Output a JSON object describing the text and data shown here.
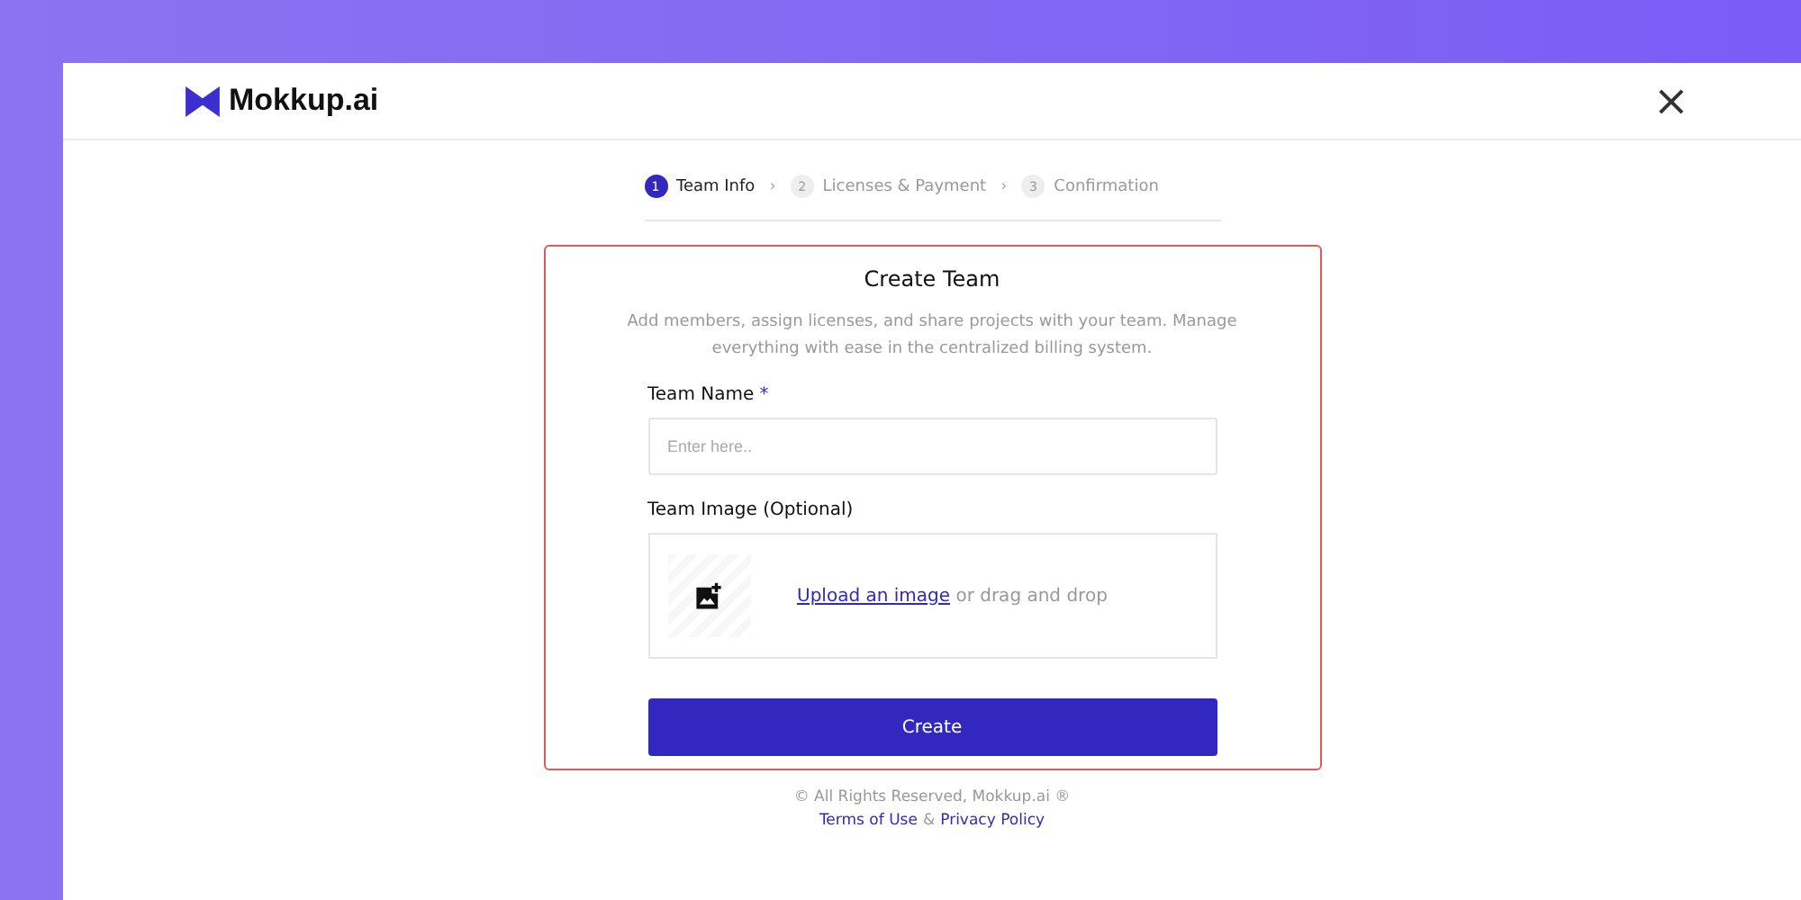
{
  "header": {
    "brand": "Mokkup.ai",
    "close": "×"
  },
  "steps": [
    {
      "number": "1",
      "label": "Team Info",
      "selected": true
    },
    {
      "number": "2",
      "label": "Licenses & Payment",
      "selected": false
    },
    {
      "number": "3",
      "label": "Confirmation",
      "selected": false
    }
  ],
  "step_separator": "›",
  "form": {
    "title": "Create Team",
    "description": "Add members, assign licenses, and share projects with your team. Manage everything with ease in the centralized billing system.",
    "fields": [
      {
        "kind": "text",
        "label": "Team Name",
        "required": true,
        "placeholder": "Enter here.."
      },
      {
        "kind": "upload",
        "label": "Team Image (Optional)",
        "required": false,
        "link": "Upload an image",
        "hint": "or drag and drop"
      }
    ],
    "submit": "Create",
    "required_mark": "*"
  },
  "footer": {
    "rights": "© All Rights Reserved, Mokkup.ai ®",
    "terms": "Terms of Use",
    "and": "&",
    "privacy": "Privacy Policy"
  }
}
